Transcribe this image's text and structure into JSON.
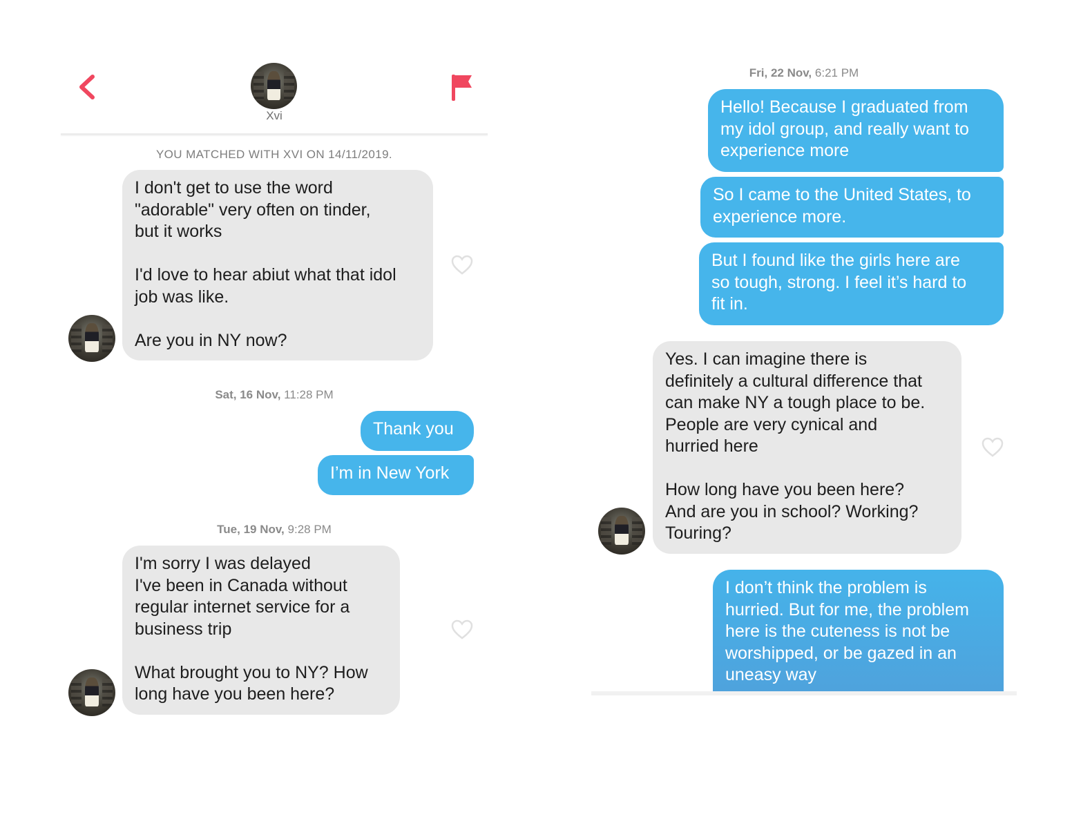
{
  "header": {
    "back_icon": "chevron-left-icon",
    "report_icon": "flag-icon",
    "match_name": "Xvi",
    "accent_color": "#f0475f"
  },
  "left": {
    "matched_banner": "YOU MATCHED WITH XVI ON 14/11/2019.",
    "msg1": "I don't get to use the word\n\"adorable\" very often on tinder,\nbut it works\n\nI'd love to hear abiut what that idol\njob was like.\n\nAre you in NY now?",
    "stamp1_day": "Sat, 16 Nov,",
    "stamp1_time": "11:28 PM",
    "reply1": "Thank you",
    "reply2": "I’m in New York",
    "stamp2_day": "Tue, 19 Nov,",
    "stamp2_time": "9:28 PM",
    "msg2": "I'm sorry I was delayed\nI've been in Canada without\nregular internet service for a\nbusiness trip\n\nWhat brought you to NY? How\nlong have you been here?"
  },
  "right": {
    "stamp_day": "Fri, 22 Nov,",
    "stamp_time": "6:21 PM",
    "out1": "Hello! Because I graduated from\nmy idol group, and really want to\nexperience more",
    "out2": "So I came to the United States, to\nexperience more.",
    "out3": "But I found like the girls here are\nso tough, strong. I feel it’s hard to\nfit in.",
    "in1": "Yes. I can imagine there is\ndefinitely a cultural difference that\ncan make NY a tough place to be.\nPeople are very cynical and\nhurried here\n\nHow long have you been here?\nAnd are you in school? Working?\nTouring?",
    "out4": "I don’t think the problem is\nhurried. But for me, the problem\nhere is the cuteness is not be\nworshipped, or be gazed in an\nuneasy way"
  },
  "colors": {
    "incoming_bubble": "#e8e8e8",
    "outgoing_bubble": "#46b5eb",
    "heart_outline": "#e0e0e0"
  }
}
